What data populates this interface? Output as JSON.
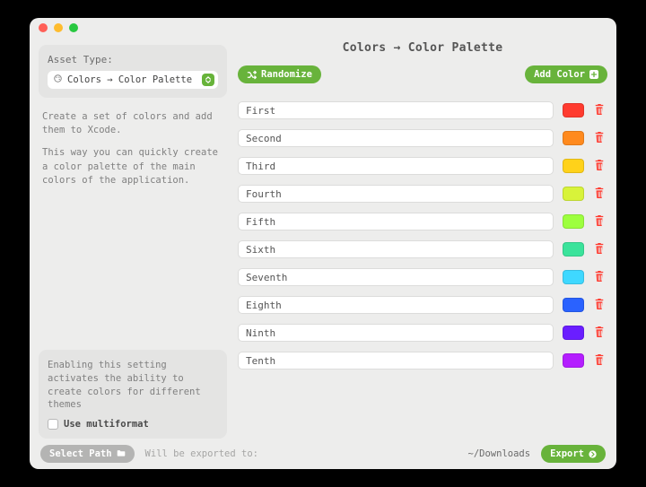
{
  "sidebar": {
    "asset_type_label": "Asset Type:",
    "asset_type_value": "Colors → Color Palette",
    "description_p1": "Create a set of colors and add them to Xcode.",
    "description_p2": "This way you can quickly create a color palette of the main colors of the application.",
    "multiformat_hint": "Enabling this setting activates the ability to create colors for different themes",
    "multiformat_label": "Use multiformat"
  },
  "main": {
    "title": "Colors → Color Palette",
    "randomize_label": "Randomize",
    "add_color_label": "Add Color",
    "colors": [
      {
        "name": "First",
        "hex": "#ff3b2f"
      },
      {
        "name": "Second",
        "hex": "#ff8a1e"
      },
      {
        "name": "Third",
        "hex": "#ffd21a"
      },
      {
        "name": "Fourth",
        "hex": "#d8f33a"
      },
      {
        "name": "Fifth",
        "hex": "#9dff3e"
      },
      {
        "name": "Sixth",
        "hex": "#3be39b"
      },
      {
        "name": "Seventh",
        "hex": "#3fd8ff"
      },
      {
        "name": "Eighth",
        "hex": "#2a62ff"
      },
      {
        "name": "Ninth",
        "hex": "#6a1eff"
      },
      {
        "name": "Tenth",
        "hex": "#b41eff"
      }
    ]
  },
  "footer": {
    "select_path_label": "Select Path",
    "export_hint": "Will be exported to:",
    "export_path": "~/Downloads",
    "export_label": "Export"
  },
  "accent": "#68b33b",
  "trash_color": "#ff3b30"
}
